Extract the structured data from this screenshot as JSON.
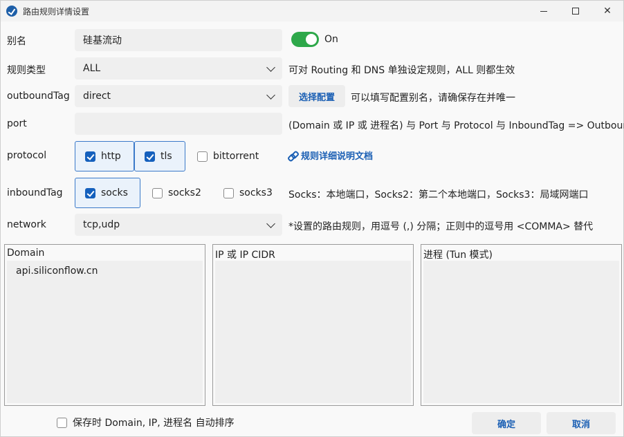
{
  "window": {
    "title": "路由规则详情设置"
  },
  "alias": {
    "label": "别名",
    "value": "硅基流动",
    "toggle_state": "on",
    "toggle_label": "On"
  },
  "rule_type": {
    "label": "规则类型",
    "value": "ALL",
    "hint": "可对 Routing 和 DNS 单独设定规则，ALL 则都生效"
  },
  "outbound": {
    "label": "outboundTag",
    "value": "direct",
    "button_label": "选择配置",
    "hint": "可以填写配置别名，请确保存在并唯一"
  },
  "port": {
    "label": "port",
    "value": "",
    "hint": "(Domain 或 IP 或 进程名) 与 Port 与 Protocol 与 InboundTag => Outbound"
  },
  "protocol": {
    "label": "protocol",
    "options": [
      {
        "label": "http",
        "checked": true
      },
      {
        "label": "tls",
        "checked": true
      },
      {
        "label": "bittorrent",
        "checked": false
      }
    ],
    "doc_link": "规则详细说明文档"
  },
  "inbound": {
    "label": "inboundTag",
    "options": [
      {
        "label": "socks",
        "checked": true
      },
      {
        "label": "socks2",
        "checked": false
      },
      {
        "label": "socks3",
        "checked": false
      }
    ],
    "hint": "Socks：本地端口，Socks2：第二个本地端口，Socks3：局域网端口"
  },
  "network": {
    "label": "network",
    "value": "tcp,udp",
    "hint": "*设置的路由规则，用逗号 (,) 分隔；正则中的逗号用 <COMMA> 替代"
  },
  "panels": {
    "domain": {
      "header": "Domain",
      "lines": [
        "api.siliconflow.cn"
      ]
    },
    "ip": {
      "header": "IP 或 IP CIDR"
    },
    "process": {
      "header": "进程 (Tun 模式)"
    }
  },
  "footer": {
    "sort_label": "保存时 Domain, IP, 进程名 自动排序",
    "sort_checked": false,
    "ok_label": "确定",
    "cancel_label": "取消"
  }
}
